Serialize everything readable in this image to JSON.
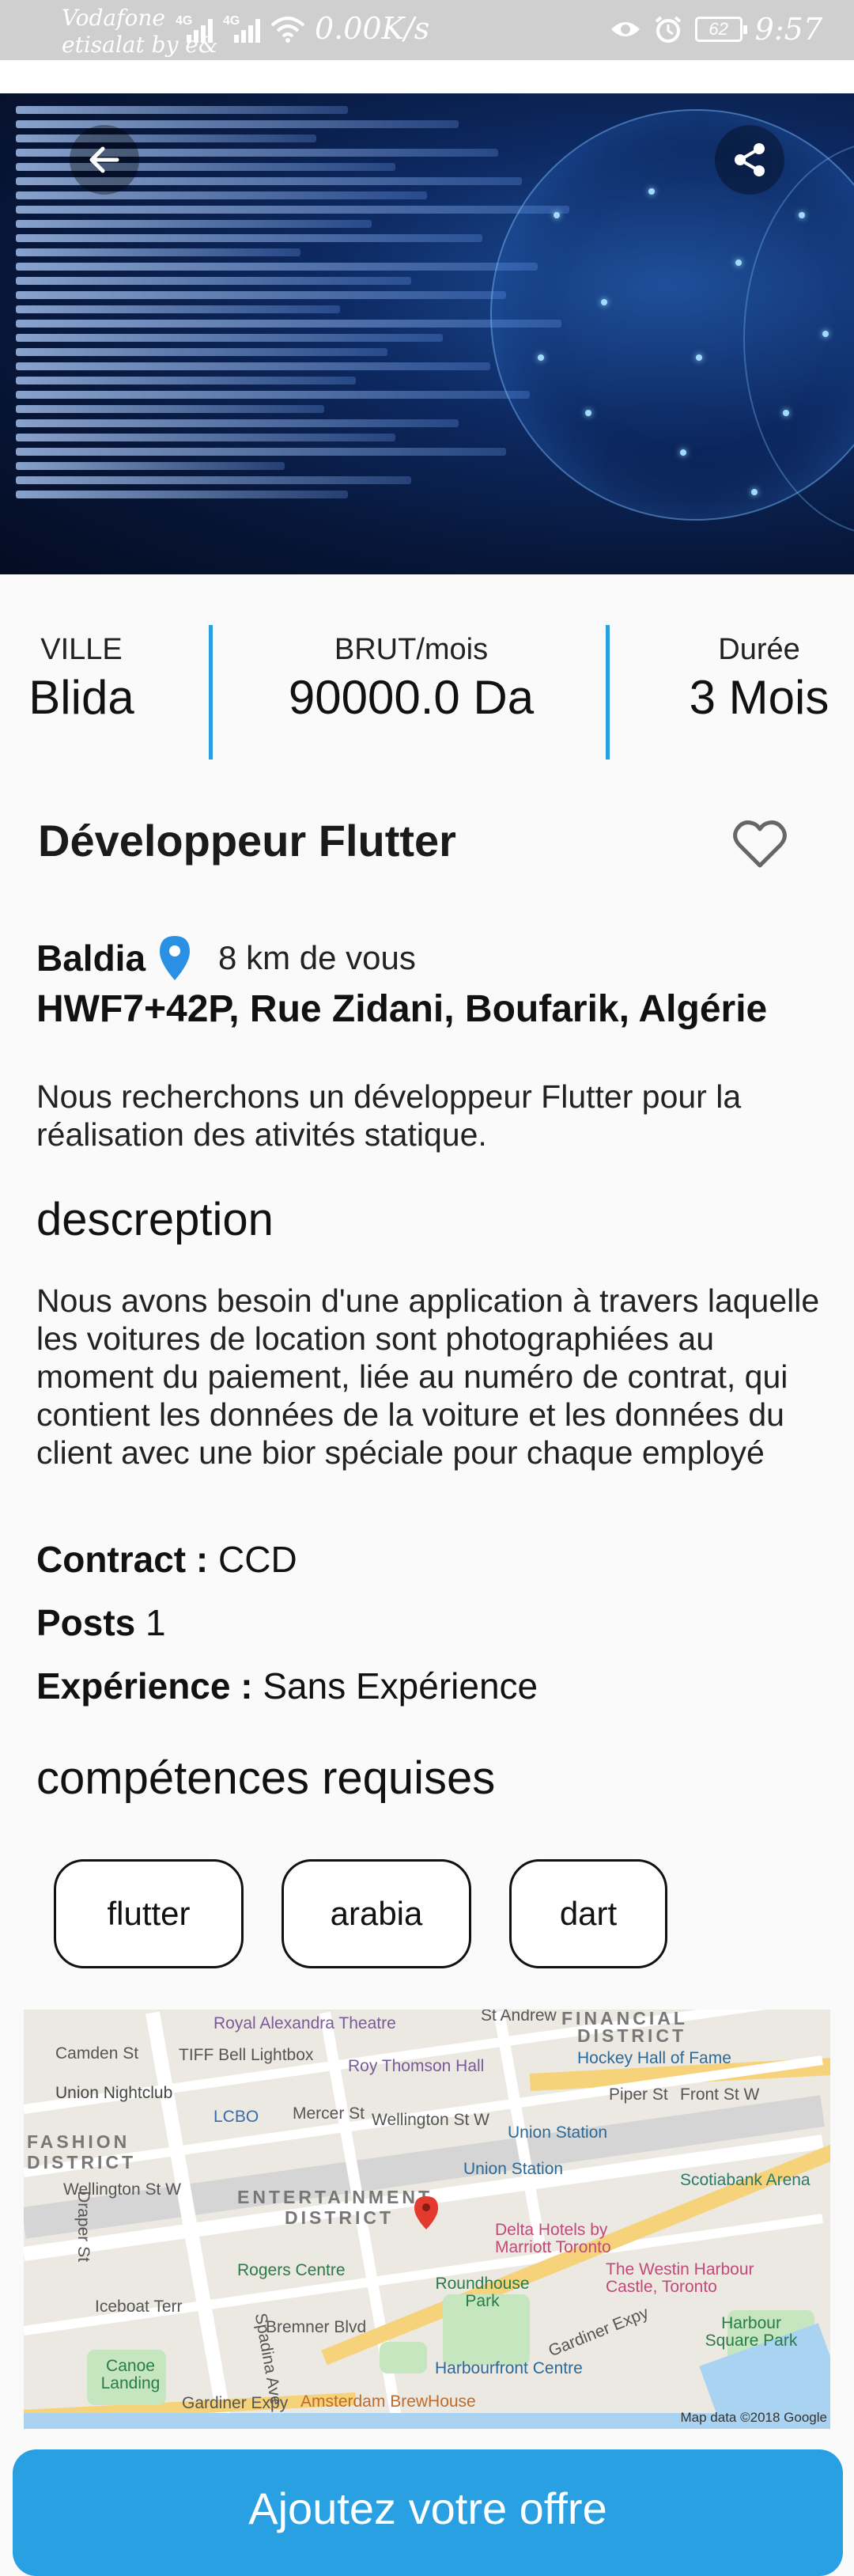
{
  "status_bar": {
    "carrier_line1": "Vodafone",
    "carrier_line2": "etisalat by e&",
    "signal1_label": "4G",
    "signal2_label": "4G",
    "net_speed": "0.00K/s",
    "battery": "62",
    "time": "9:57"
  },
  "hero": {
    "back_icon": "arrow-left-icon",
    "share_icon": "share-icon"
  },
  "stats": {
    "city_label": "VILLE",
    "city_value": "Blida",
    "salary_label": "BRUT/mois",
    "salary_value": "90000.0 Da",
    "duration_label": "Durée",
    "duration_value": "3 Mois"
  },
  "job": {
    "title": "Développeur Flutter",
    "favorite_icon": "heart-outline-icon",
    "commune": "Baldia",
    "distance": "8 km de vous",
    "address": "HWF7+42P, Rue Zidani, Boufarik, Algérie",
    "summary": "Nous recherchons un développeur Flutter pour la réalisation des ativités statique.",
    "description_heading": "descreption",
    "description": "Nous avons besoin d'une application à travers laquelle les voitures de location sont photographiées au moment du paiement, liée au numéro de contrat, qui contient les données de la voiture et les données du client avec une bior spéciale pour chaque employé",
    "contract_label": "Contract :",
    "contract_value": "CCD",
    "posts_label": "Posts",
    "posts_value": "1",
    "experience_label": "Expérience :",
    "experience_value": "Sans Expérience",
    "skills_heading": "compétences requises",
    "skills": [
      "flutter",
      "arabia",
      "dart"
    ]
  },
  "map": {
    "labels": {
      "royal_alexandra": "Royal Alexandra Theatre",
      "st_andrew": "St Andrew",
      "financial": "FINANCIAL",
      "district": "DISTRICT",
      "camden": "Camden St",
      "tiff": "TIFF Bell Lightbox",
      "roy_thomson": "Roy Thomson Hall",
      "hockey": "Hockey Hall of Fame",
      "union_nightclub": "Union Nightclub",
      "lcbo": "LCBO",
      "mercer": "Mercer St",
      "wellington": "Wellington St W",
      "piper": "Piper St",
      "front": "Front St W",
      "fashion": "FASHION",
      "fashion_district": "DISTRICT",
      "union_station": "Union Station",
      "union_station2": "Union Station",
      "scotiabank": "Scotiabank Arena",
      "wellington2": "Wellington St W",
      "entertainment": "ENTERTAINMENT",
      "ent_district": "DISTRICT",
      "delta": "Delta Hotels by Marriott Toronto",
      "draper": "Draper St",
      "rogers": "Rogers Centre",
      "roundhouse": "Roundhouse Park",
      "westin": "The Westin Harbour Castle, Toronto",
      "iceboat": "Iceboat Terr",
      "bremner": "Bremner Blvd",
      "spadina": "Spadina Ave",
      "gardiner": "Gardiner Expy",
      "harbour_square": "Harbour Square Park",
      "canoe": "Canoe Landing",
      "harbourfront": "Harbourfront Centre",
      "gardiner2": "Gardiner Expy",
      "amsterdam": "Amsterdam BrewHouse",
      "attribution": "Map data ©2018 Google"
    }
  },
  "cta": {
    "label": "Ajoutez votre offre"
  }
}
